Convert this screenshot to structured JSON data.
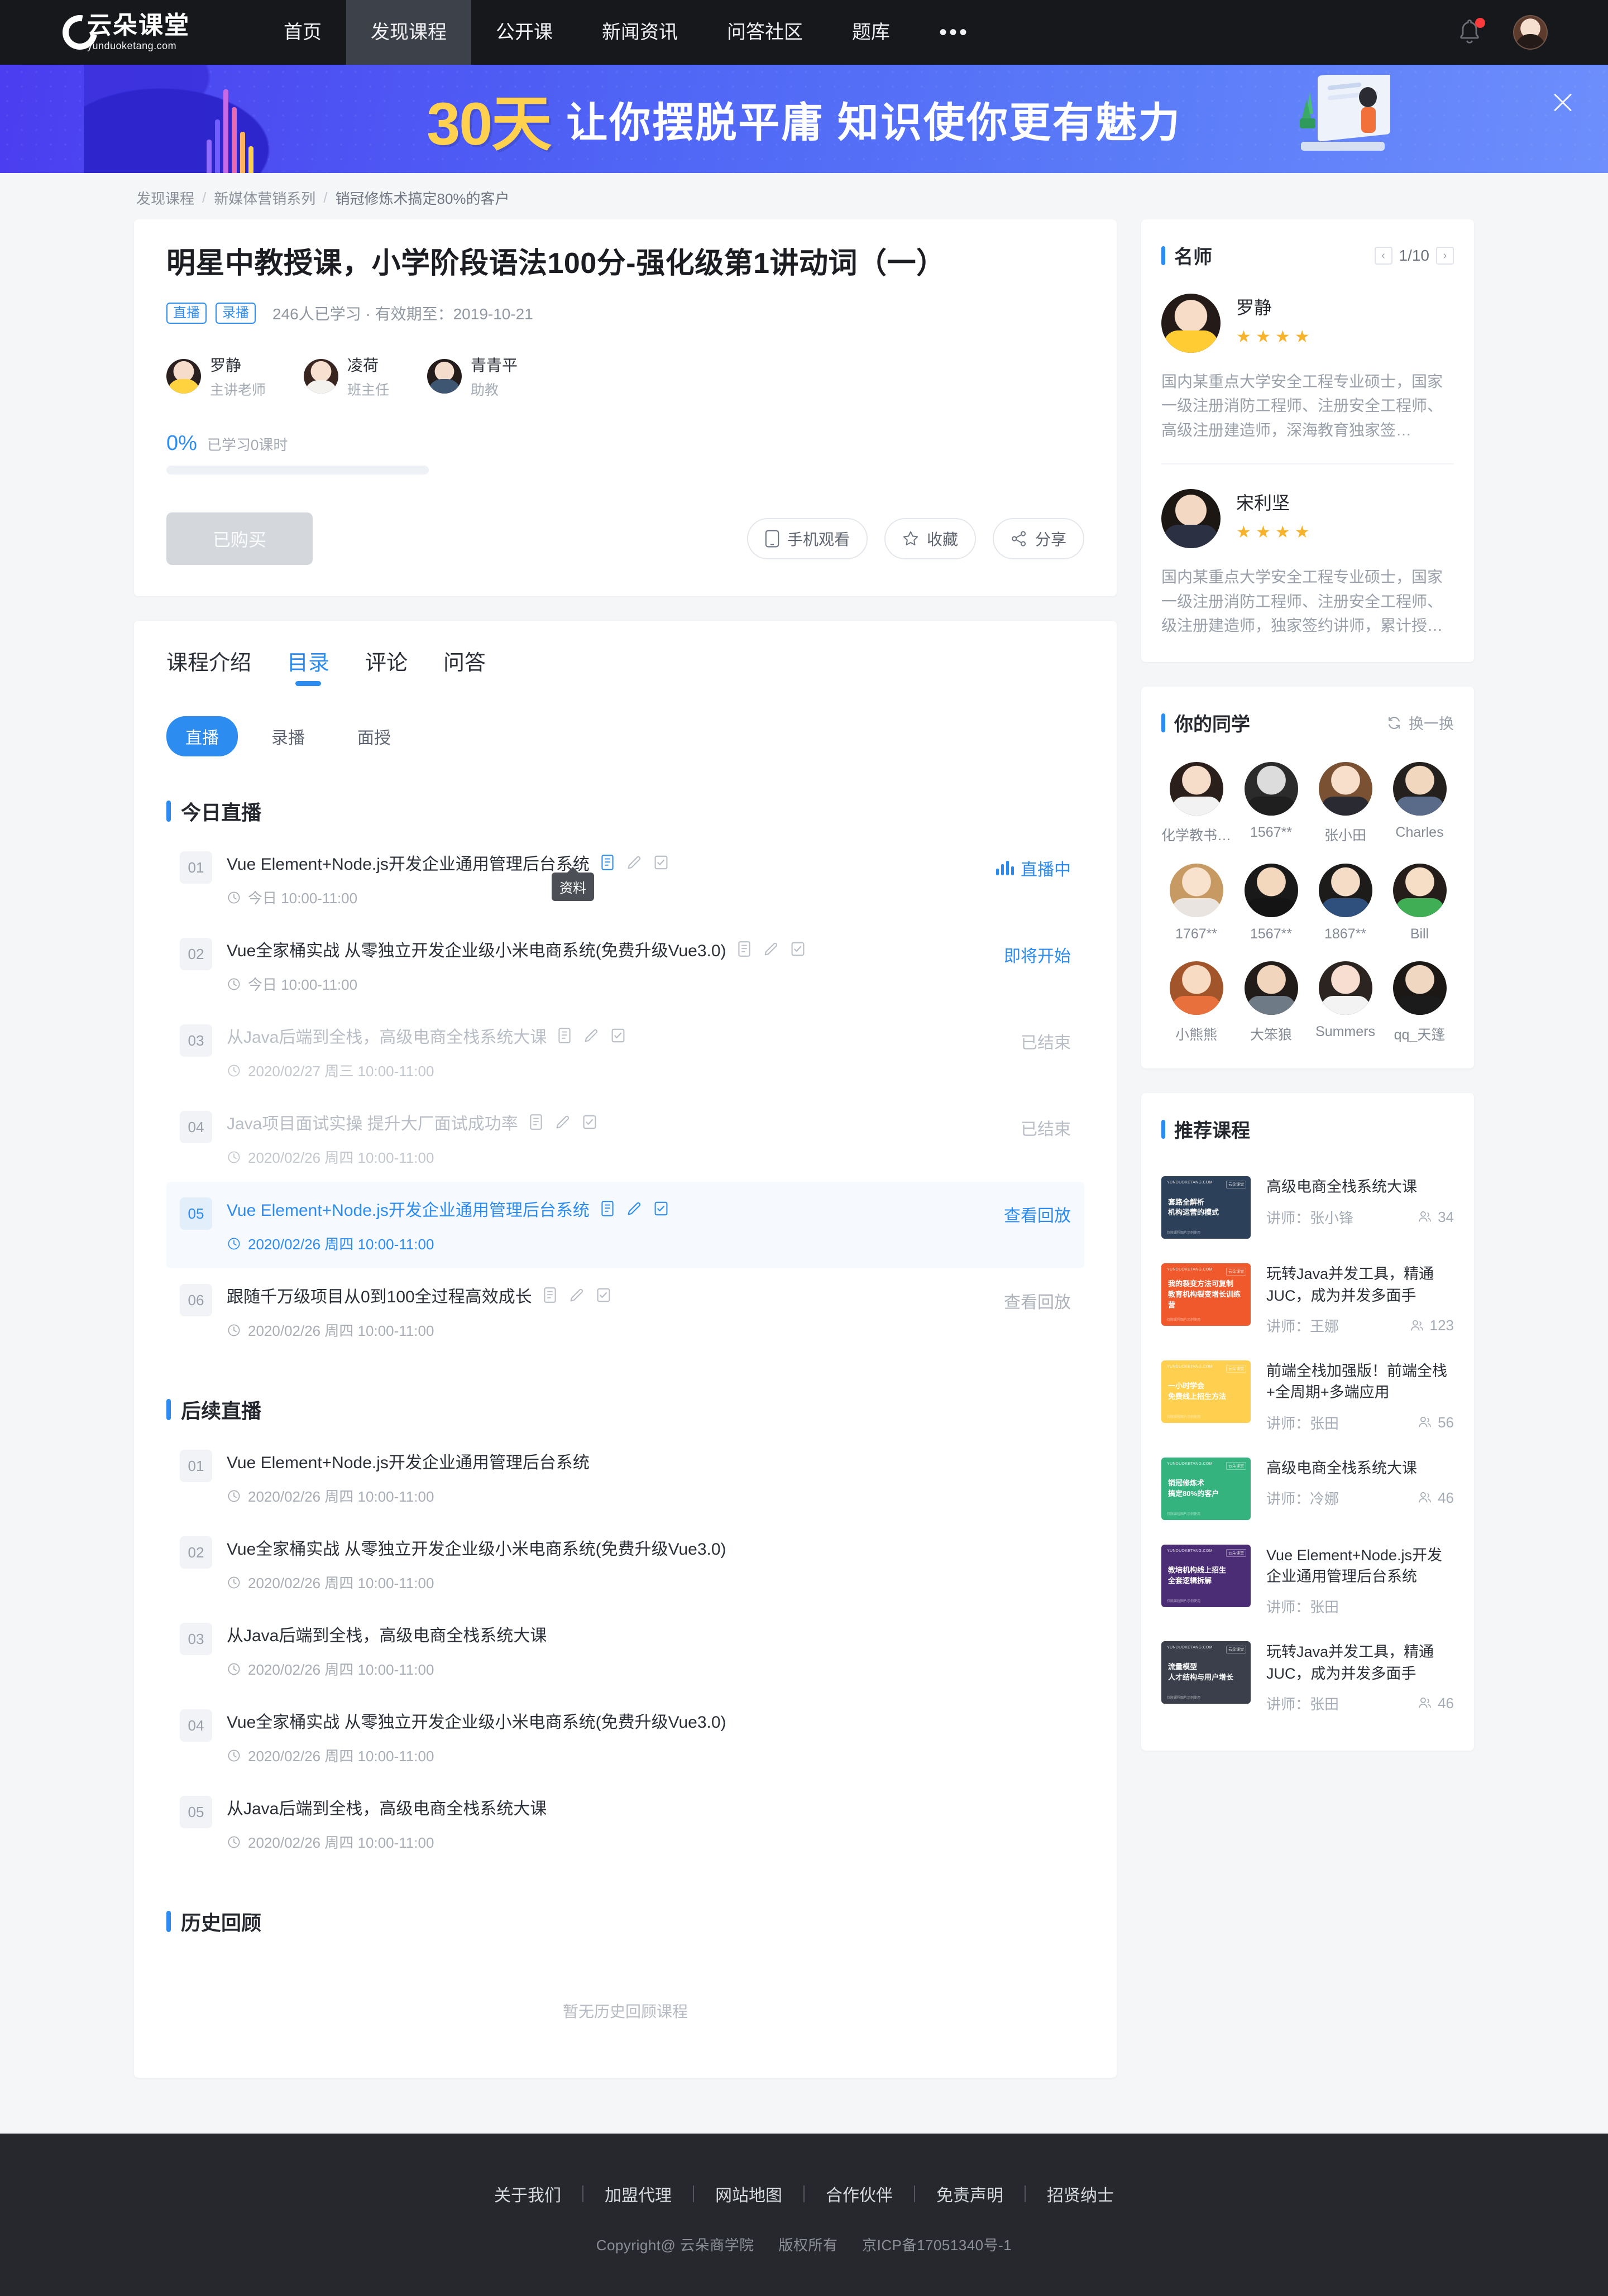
{
  "header": {
    "logo_cn": "云朵课堂",
    "logo_en": "yunduoketang.com",
    "nav": [
      {
        "label": "首页",
        "active": false
      },
      {
        "label": "发现课程",
        "active": true
      },
      {
        "label": "公开课",
        "active": false
      },
      {
        "label": "新闻资讯",
        "active": false
      },
      {
        "label": "问答社区",
        "active": false
      },
      {
        "label": "题库",
        "active": false
      }
    ],
    "more": "•••",
    "bell_icon": "bell-icon",
    "avatar_icon": "user-avatar"
  },
  "banner": {
    "highlight": "30天",
    "slogan": "让你摆脱平庸  知识使你更有魅力",
    "close_icon": "close-icon"
  },
  "breadcrumb": {
    "items": [
      "发现课程",
      "新媒体营销系列",
      "销冠修炼术搞定80%的客户"
    ],
    "separator": "/"
  },
  "course": {
    "title": "明星中教授课，小学阶段语法100分-强化级第1讲动词（一）",
    "tags": [
      "直播",
      "录播"
    ],
    "meta": "246人已学习 · 有效期至：2019-10-21",
    "teachers": [
      {
        "name": "罗静",
        "role": "主讲老师"
      },
      {
        "name": "凌荷",
        "role": "班主任"
      },
      {
        "name": "青青平",
        "role": "助教"
      }
    ],
    "progress_pct": "0%",
    "progress_value": 0,
    "progress_label": "已学习0课时",
    "buy_button": "已购买",
    "actions": [
      {
        "label": "手机观看",
        "icon": "phone-icon"
      },
      {
        "label": "收藏",
        "icon": "star-icon"
      },
      {
        "label": "分享",
        "icon": "share-icon"
      }
    ]
  },
  "detail": {
    "tabs": [
      {
        "label": "课程介绍",
        "active": false
      },
      {
        "label": "目录",
        "active": true
      },
      {
        "label": "评论",
        "active": false
      },
      {
        "label": "问答",
        "active": false
      }
    ],
    "subtabs": [
      {
        "label": "直播",
        "active": true
      },
      {
        "label": "录播",
        "active": false
      },
      {
        "label": "面授",
        "active": false
      }
    ],
    "tooltip": "资料",
    "sections": [
      {
        "title": "今日直播",
        "show_icons": true,
        "lessons": [
          {
            "no": "01",
            "title": "Vue Element+Node.js开发企业通用管理后台系统",
            "time": "今日 10:00-11:00",
            "status": "直播中",
            "state": "live"
          },
          {
            "no": "02",
            "title": "Vue全家桶实战 从零独立开发企业级小米电商系统(免费升级Vue3.0)",
            "time": "今日 10:00-11:00",
            "status": "即将开始",
            "state": "soon"
          },
          {
            "no": "03",
            "title": "从Java后端到全栈，高级电商全栈系统大课",
            "time": "2020/02/27 周三 10:00-11:00",
            "status": "已结束",
            "state": "ended"
          },
          {
            "no": "04",
            "title": "Java项目面试实操 提升大厂面试成功率",
            "time": "2020/02/26 周四 10:00-11:00",
            "status": "已结束",
            "state": "ended"
          },
          {
            "no": "05",
            "title": "Vue Element+Node.js开发企业通用管理后台系统",
            "time": "2020/02/26 周四 10:00-11:00",
            "status": "查看回放",
            "state": "replay-active"
          },
          {
            "no": "06",
            "title": "跟随千万级项目从0到100全过程高效成长",
            "time": "2020/02/26 周四 10:00-11:00",
            "status": "查看回放",
            "state": "replay"
          }
        ]
      },
      {
        "title": "后续直播",
        "show_icons": false,
        "lessons": [
          {
            "no": "01",
            "title": "Vue Element+Node.js开发企业通用管理后台系统",
            "time": "2020/02/26 周四 10:00-11:00",
            "status": "",
            "state": "plain"
          },
          {
            "no": "02",
            "title": "Vue全家桶实战 从零独立开发企业级小米电商系统(免费升级Vue3.0)",
            "time": "2020/02/26 周四 10:00-11:00",
            "status": "",
            "state": "plain"
          },
          {
            "no": "03",
            "title": "从Java后端到全栈，高级电商全栈系统大课",
            "time": "2020/02/26 周四 10:00-11:00",
            "status": "",
            "state": "plain"
          },
          {
            "no": "04",
            "title": "Vue全家桶实战 从零独立开发企业级小米电商系统(免费升级Vue3.0)",
            "time": "2020/02/26 周四 10:00-11:00",
            "status": "",
            "state": "plain"
          },
          {
            "no": "05",
            "title": "从Java后端到全栈，高级电商全栈系统大课",
            "time": "2020/02/26 周四 10:00-11:00",
            "status": "",
            "state": "plain"
          }
        ]
      }
    ],
    "history": {
      "title": "历史回顾",
      "empty_text": "暂无历史回顾课程"
    }
  },
  "sidebar": {
    "teacher_panel": {
      "title": "名师",
      "page": "1/10",
      "prev_icon": "chevron-left-icon",
      "next_icon": "chevron-right-icon",
      "teachers": [
        {
          "name": "罗静",
          "stars": 4,
          "desc": "国内某重点大学安全工程专业硕士，国家一级注册消防工程师、注册安全工程师、高级注册建造师，深海教育独家签…"
        },
        {
          "name": "宋利坚",
          "stars": 4,
          "desc": "国内某重点大学安全工程专业硕士，国家一级注册消防工程师、注册安全工程师、级注册建造师，独家签约讲师，累计授…"
        }
      ]
    },
    "classmates_panel": {
      "title": "你的同学",
      "refresh_label": "换一换",
      "refresh_icon": "refresh-icon",
      "mates": [
        {
          "name": "化学教书…"
        },
        {
          "name": "1567**"
        },
        {
          "name": "张小田"
        },
        {
          "name": "Charles"
        },
        {
          "name": "1767**"
        },
        {
          "name": "1567**"
        },
        {
          "name": "1867**"
        },
        {
          "name": "Bill"
        },
        {
          "name": "小熊熊"
        },
        {
          "name": "大笨狼"
        },
        {
          "name": "Summers"
        },
        {
          "name": "qq_天篷"
        }
      ]
    },
    "recommend_panel": {
      "title": "推荐课程",
      "courses": [
        {
          "name": "高级电商全栈系统大课",
          "teacher": "讲师：张小锋",
          "count": "34",
          "thumb_color": "#2d4059",
          "thumb_line1": "套路全解析",
          "thumb_line2": "机构运营的模式",
          "thumb_brand": "YUNDUOKETANG.COM",
          "thumb_badge": "云朵课堂",
          "thumb_foot": "仅限课程图片示例使用"
        },
        {
          "name": "玩转Java并发工具，精通JUC，成为并发多面手",
          "teacher": "讲师：王娜",
          "count": "123",
          "thumb_color": "#f0592b",
          "thumb_line1": "我的裂变方法可复制",
          "thumb_line2": "教育机构裂变增长训练营",
          "thumb_brand": "YUNDUOKETANG.COM",
          "thumb_badge": "云朵课堂",
          "thumb_foot": "仅限课程图片示例使用"
        },
        {
          "name": "前端全栈加强版！前端全栈+全周期+多端应用",
          "teacher": "讲师：张田",
          "count": "56",
          "thumb_color": "#ffd050",
          "thumb_line1": "一小时学会",
          "thumb_line2": "免费线上招生方法",
          "thumb_brand": "YUNDUOKETANG.COM",
          "thumb_badge": "云朵课堂",
          "thumb_foot": "仅限课程图片示例使用"
        },
        {
          "name": "高级电商全栈系统大课",
          "teacher": "讲师：冷娜",
          "count": "46",
          "thumb_color": "#34b37e",
          "thumb_line1": "销冠修炼术",
          "thumb_line2": "搞定80%的客户",
          "thumb_brand": "YUNDUOKETANG.COM",
          "thumb_badge": "云朵课堂",
          "thumb_foot": "仅限课程图片示例使用"
        },
        {
          "name": "Vue Element+Node.js开发企业通用管理后台系统",
          "teacher": "讲师：张田",
          "count": "",
          "thumb_color": "#4b2d75",
          "thumb_line1": "教培机构线上招生",
          "thumb_line2": "全套逻辑拆解",
          "thumb_brand": "YUNDUOKETANG.COM",
          "thumb_badge": "云朵课堂",
          "thumb_foot": "仅限课程图片示例使用"
        },
        {
          "name": "玩转Java并发工具，精通JUC，成为并发多面手",
          "teacher": "讲师：张田",
          "count": "46",
          "thumb_color": "#3a3f4b",
          "thumb_line1": "流量模型",
          "thumb_line2": "人才结构与用户增长",
          "thumb_brand": "YUNDUOKETANG.COM",
          "thumb_badge": "云朵课堂",
          "thumb_foot": "仅限课程图片示例使用"
        }
      ]
    }
  },
  "footer": {
    "links": [
      "关于我们",
      "加盟代理",
      "网站地图",
      "合作伙伴",
      "免责声明",
      "招贤纳士"
    ],
    "copyright": "Copyright@ 云朵商学院",
    "rights": "版权所有",
    "icp": "京ICP备17051340号-1"
  },
  "theme": {
    "accent": "#2d8cf0",
    "header_bg": "#17181c",
    "page_bg": "#f5f6f8",
    "star": "#f7b32b"
  }
}
